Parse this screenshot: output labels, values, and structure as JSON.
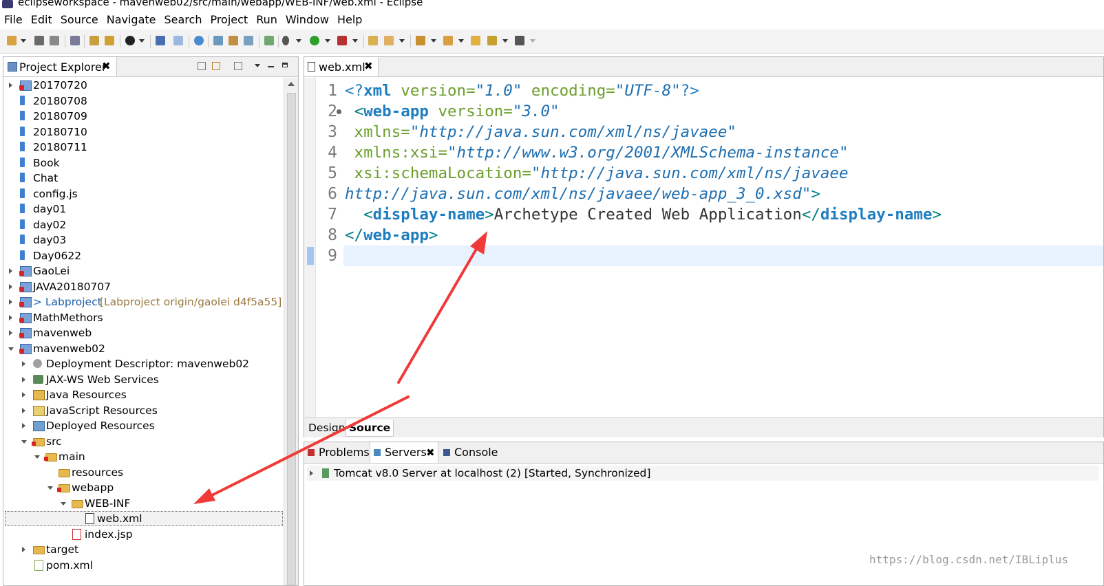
{
  "window": {
    "title": "eclipseworkspace - mavenweb02/src/main/webapp/WEB-INF/web.xml - Eclipse"
  },
  "menu": [
    "File",
    "Edit",
    "Source",
    "Navigate",
    "Search",
    "Project",
    "Run",
    "Window",
    "Help"
  ],
  "explorer": {
    "tab_label": "Project Explorer",
    "close": "✖",
    "tree": [
      {
        "label": "20170720",
        "icon": "project-icon"
      },
      {
        "label": "20180708",
        "icon": "folder-icon"
      },
      {
        "label": "20180709",
        "icon": "folder-icon"
      },
      {
        "label": "20180710",
        "icon": "folder-icon"
      },
      {
        "label": "20180711",
        "icon": "folder-icon"
      },
      {
        "label": "Book",
        "icon": "folder-icon"
      },
      {
        "label": "Chat",
        "icon": "folder-icon"
      },
      {
        "label": "config.js",
        "icon": "folder-icon"
      },
      {
        "label": "day01",
        "icon": "folder-icon"
      },
      {
        "label": "day02",
        "icon": "folder-icon"
      },
      {
        "label": "day03",
        "icon": "folder-icon"
      },
      {
        "label": "Day0622",
        "icon": "folder-icon"
      },
      {
        "label": "GaoLei",
        "icon": "project-icon"
      },
      {
        "label": "JAVA20180707",
        "icon": "project-icon"
      },
      {
        "label": "> Labproject",
        "suffix": "[Labproject origin/gaolei d4f5a55]",
        "icon": "project-icon"
      },
      {
        "label": "MathMethors",
        "icon": "project-icon"
      },
      {
        "label": "mavenweb",
        "icon": "project-icon"
      },
      {
        "label": "mavenweb02",
        "icon": "project-icon"
      },
      {
        "label": "Deployment Descriptor: mavenweb02",
        "icon": "descriptor-icon"
      },
      {
        "label": "JAX-WS Web Services",
        "icon": "webservices-icon"
      },
      {
        "label": "Java Resources",
        "icon": "java-resources-icon"
      },
      {
        "label": "JavaScript Resources",
        "icon": "js-resources-icon"
      },
      {
        "label": "Deployed Resources",
        "icon": "deployed-resources-icon"
      },
      {
        "label": "src",
        "icon": "source-folder-icon"
      },
      {
        "label": "main",
        "icon": "source-folder-icon"
      },
      {
        "label": "resources",
        "icon": "folder-icon"
      },
      {
        "label": "webapp",
        "icon": "source-folder-icon"
      },
      {
        "label": "WEB-INF",
        "icon": "folder-icon"
      },
      {
        "label": "web.xml",
        "icon": "xml-file-icon"
      },
      {
        "label": "index.jsp",
        "icon": "jsp-file-icon"
      },
      {
        "label": "target",
        "icon": "folder-icon"
      },
      {
        "label": "pom.xml",
        "icon": "xml-file-icon"
      }
    ]
  },
  "editor": {
    "tab_label": "web.xml",
    "close": "✖",
    "line_numbers": [
      "1",
      "2",
      "3",
      "4",
      "5",
      "6",
      "7",
      "8",
      "9"
    ],
    "code": {
      "l1a": "<?",
      "l1b": "xml",
      "l1c": " version=",
      "l1d": "\"1.0\"",
      "l1e": " encoding=",
      "l1f": "\"UTF-8\"",
      "l1g": "?>",
      "l2a": " <",
      "l2b": "web-app",
      "l2c": " version=",
      "l2d": "\"3.0\"",
      "l3a": " xmlns=",
      "l3b": "\"http://java.sun.com/xml/ns/javaee\"",
      "l4a": " xmlns:xsi=",
      "l4b": "\"http://www.w3.org/2001/XMLSchema-instance\"",
      "l5a": " xsi:schemaLocation=",
      "l5b": "\"http://java.sun.com/xml/ns/javaee",
      "l6a": "http://java.sun.com/xml/ns/javaee/web-app_3_0.xsd\"",
      "l6b": ">",
      "l7a": "  <",
      "l7b": "display-name",
      "l7c": ">",
      "l7d": "Archetype Created Web Application",
      "l7e": "</",
      "l7f": "display-name",
      "l7g": ">",
      "l8a": "</",
      "l8b": "web-app",
      "l8c": ">"
    },
    "tabs": [
      "Design",
      "Source"
    ]
  },
  "bottom": {
    "tabs": [
      "Problems",
      "Servers",
      "Console"
    ],
    "close": "✖",
    "server": "Tomcat v8.0 Server at localhost (2)  [Started, Synchronized]"
  },
  "watermark": "https://blog.csdn.net/IBLiplus",
  "colors": {
    "arrow": "#f03a3a",
    "tag_name": "#1f7ec0",
    "attr_name": "#6c9e2c",
    "attr_value": "#1f6fb0"
  }
}
